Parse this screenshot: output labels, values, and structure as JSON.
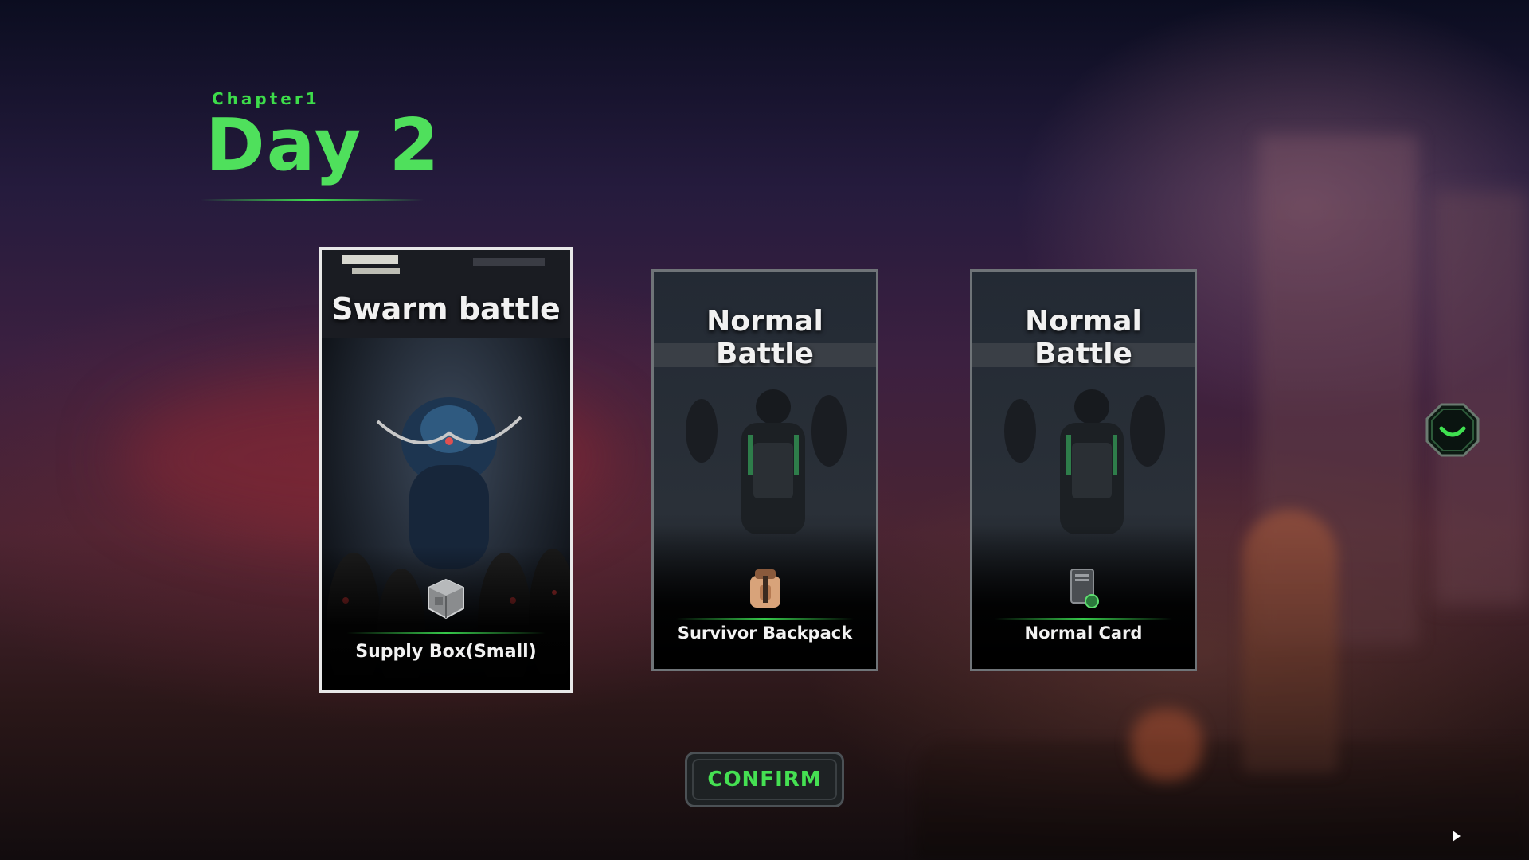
{
  "header": {
    "chapter": "Chapter1",
    "day": "Day 2"
  },
  "cards": [
    {
      "title": "Swarm battle",
      "reward": "Supply Box(Small)",
      "reward_icon": "supply-box-icon",
      "selected": true
    },
    {
      "title": "Normal Battle",
      "reward": "Survivor Backpack",
      "reward_icon": "backpack-icon",
      "selected": false
    },
    {
      "title": "Normal Battle",
      "reward": "Normal Card",
      "reward_icon": "card-icon",
      "selected": false
    }
  ],
  "actions": {
    "confirm_label": "CONFIRM",
    "emote_icon": "smile-icon"
  },
  "colors": {
    "accent": "#45e052",
    "selected_border": "#e8e8e8",
    "card_border": "#6f7478"
  }
}
